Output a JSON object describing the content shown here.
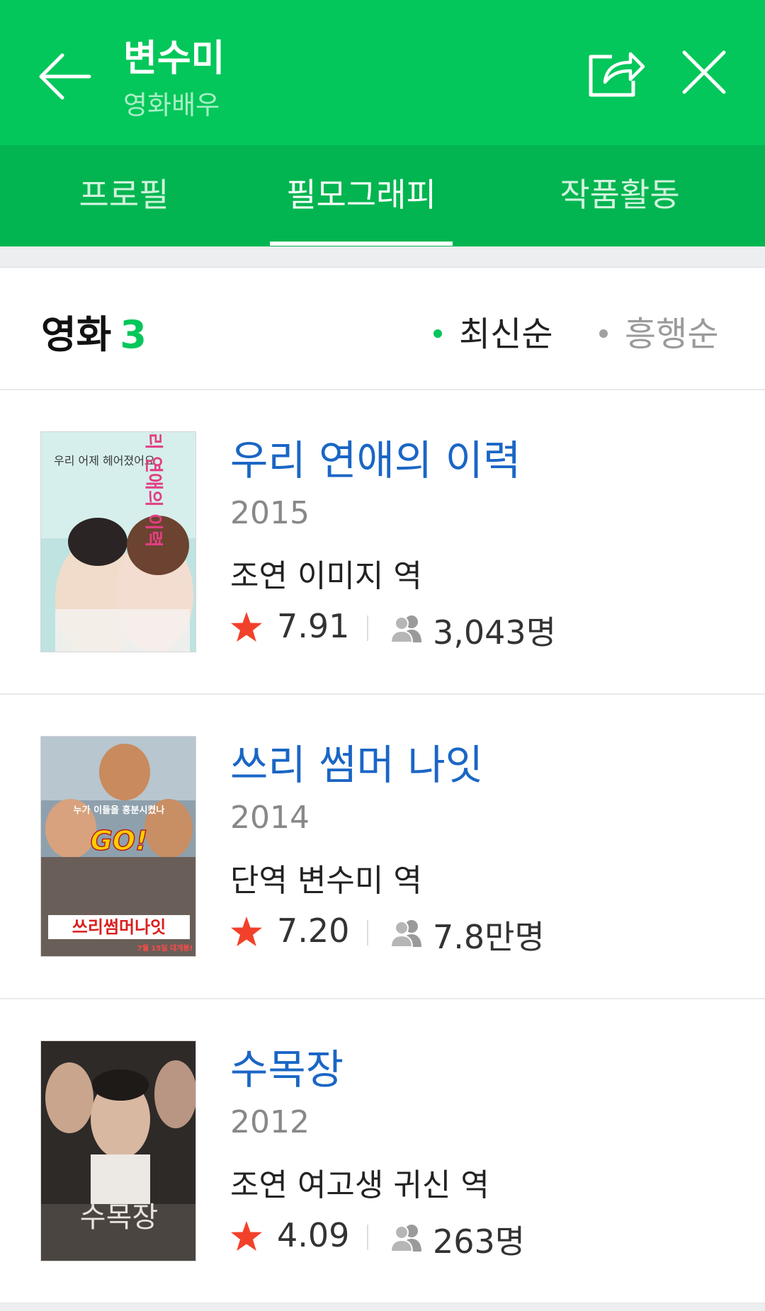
{
  "header": {
    "title": "변수미",
    "subtitle": "영화배우",
    "background_color": "#03c75a",
    "icons": [
      "back-arrow-icon",
      "share-icon",
      "close-icon"
    ]
  },
  "tabs": [
    {
      "label": "프로필",
      "active": false
    },
    {
      "label": "필모그래피",
      "active": true
    },
    {
      "label": "작품활동",
      "active": false
    }
  ],
  "section": {
    "title": "영화",
    "count": "3",
    "sort_options": [
      {
        "label": "최신순",
        "selected": true
      },
      {
        "label": "흥행순",
        "selected": false
      }
    ]
  },
  "movies": [
    {
      "title": "우리 연애의 이력",
      "year": "2015",
      "role": "조연 이미지 역",
      "rating": "7.91",
      "audience": "3,043명",
      "poster_texts": [
        "우리 어제 헤어졌어요",
        "우리 연애의 이력"
      ]
    },
    {
      "title": "쓰리 썸머 나잇",
      "year": "2014",
      "role": "단역 변수미 역",
      "rating": "7.20",
      "audience": "7.8만명",
      "poster_texts": [
        "누가 이들을 흥분시켰나",
        "GO!",
        "쓰리썸머나잇",
        "7월 15일 대개봉!"
      ]
    },
    {
      "title": "수목장",
      "year": "2012",
      "role": "조연 여고생 귀신 역",
      "rating": "4.09",
      "audience": "263명",
      "poster_texts": [
        "수목장"
      ]
    }
  ],
  "colors": {
    "brand_green": "#03c75a",
    "title_blue": "#1a66c5",
    "star_red": "#f2412b"
  }
}
